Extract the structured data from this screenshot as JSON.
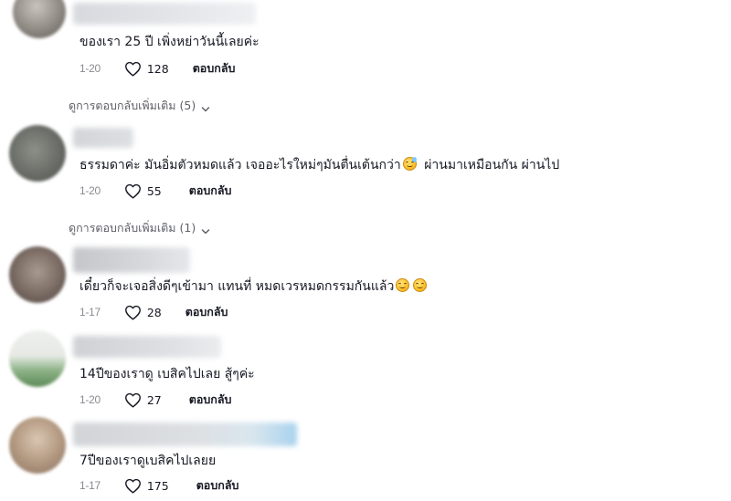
{
  "comments": [
    {
      "text": "ของเรา 25 ปี เพิ่งหย่าวันนี้เลยค่ะ",
      "date": "1-20",
      "likes": "128",
      "reply_label": "ตอบกลับ"
    },
    {
      "text": "ธรรมดาค่ะ มันอิ่มตัวหมดแล้ว เจออะไรใหม่ๆมันตื่นเต้นกว่า",
      "text_after": "ผ่านมาเหมือนกัน ผ่านไป",
      "date": "1-20",
      "likes": "55",
      "reply_label": "ตอบกลับ"
    },
    {
      "text": "เดี๋ยวก็จะเจอสิ่งดีๆเข้ามา แทนที่ หมดเวรหมดกรรมกันแล้ว",
      "date": "1-17",
      "likes": "28",
      "reply_label": "ตอบกลับ"
    },
    {
      "text": "14ปีของเราดู เบสิคไปเลย สู้ๆค่ะ",
      "date": "1-20",
      "likes": "27",
      "reply_label": "ตอบกลับ"
    },
    {
      "text": "7ปีของเราดูเบสิคไปเลยย",
      "date": "1-17",
      "likes": "175",
      "reply_label": "ตอบกลับ"
    }
  ],
  "view_more": [
    {
      "label": "ดูการตอบกลับเพิ่มเติม (5)"
    },
    {
      "label": "ดูการตอบกลับเพิ่มเติม (1)"
    }
  ],
  "icons": {
    "like": "heart-outline-icon",
    "expand": "chevron-down-icon",
    "emoji_sweat": "grinning-sweat-emoji-icon",
    "emoji_smile": "smiling-face-emoji-icon"
  },
  "colors": {
    "text_primary": "#161823",
    "text_secondary": "#8a8b91",
    "view_more": "#5f6068",
    "emoji": "#ffc32e"
  }
}
